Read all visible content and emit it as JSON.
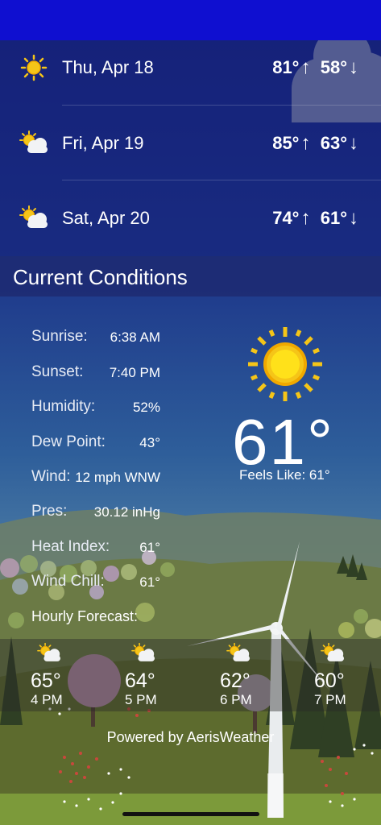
{
  "daily": [
    {
      "date": "Thu, Apr 18",
      "high": "81°",
      "low": "58°",
      "icon": "sun-icon"
    },
    {
      "date": "Fri, Apr 19",
      "high": "85°",
      "low": "63°",
      "icon": "partly-cloudy-icon"
    },
    {
      "date": "Sat, Apr 20",
      "high": "74°",
      "low": "61°",
      "icon": "partly-cloudy-icon"
    }
  ],
  "arrows": {
    "up": "↑",
    "down": "↓"
  },
  "current": {
    "title": "Current Conditions",
    "sunrise_label": "Sunrise:",
    "sunrise": "6:38 AM",
    "sunset_label": "Sunset:",
    "sunset": "7:40 PM",
    "humidity_label": "Humidity:",
    "humidity": "52%",
    "dew_label": "Dew Point:",
    "dew": "43°",
    "wind_label": "Wind:",
    "wind": "12 mph WNW",
    "pres_label": "Pres:",
    "pres": "30.12 inHg",
    "heat_label": "Heat Index:",
    "heat": "61°",
    "chill_label": "Wind Chill:",
    "chill": "61°",
    "temp": "61°",
    "feels": "Feels Like: 61°",
    "icon": "sun-icon"
  },
  "hourly_label": "Hourly Forecast:",
  "hourly": [
    {
      "temp": "65°",
      "time": "4 PM",
      "icon": "partly-cloudy-icon"
    },
    {
      "temp": "64°",
      "time": "5 PM",
      "icon": "partly-cloudy-icon"
    },
    {
      "temp": "62°",
      "time": "6 PM",
      "icon": "partly-cloudy-icon"
    },
    {
      "temp": "60°",
      "time": "7 PM",
      "icon": "partly-cloudy-icon"
    }
  ],
  "powered_by": "Powered by AerisWeather",
  "colors": {
    "sun": "#f5c518",
    "top_bar": "#0f0fd0"
  }
}
